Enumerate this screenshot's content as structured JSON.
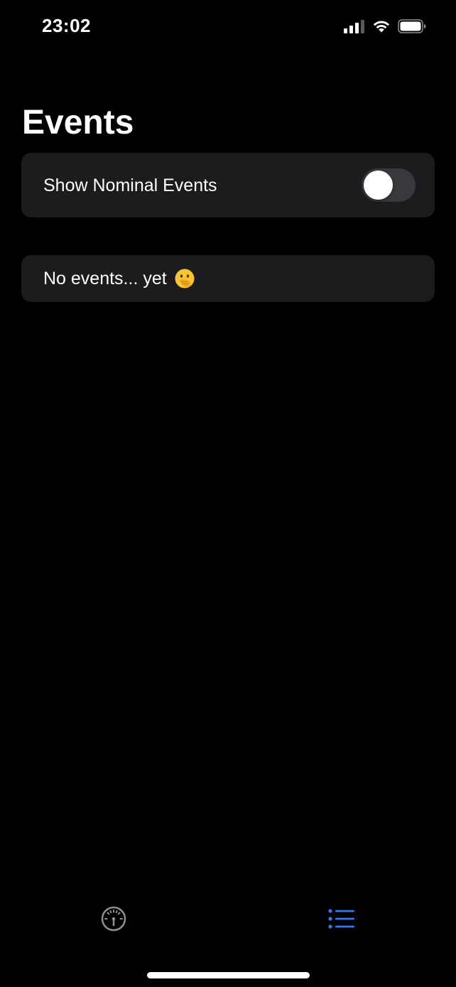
{
  "status_bar": {
    "time": "23:02",
    "icons": [
      "cellular-signal-icon",
      "wifi-icon",
      "battery-icon"
    ]
  },
  "header": {
    "title": "Events"
  },
  "settings": {
    "show_nominal_events_label": "Show Nominal Events",
    "show_nominal_events_enabled": false
  },
  "events": {
    "empty_message": "No events... yet",
    "empty_emoji": "face-with-hand-over-mouth-icon"
  },
  "tab_bar": {
    "tabs": [
      {
        "icon": "gauge-icon",
        "selected": false
      },
      {
        "icon": "list-icon",
        "selected": true
      }
    ]
  },
  "colors": {
    "background": "#000000",
    "card": "#1c1c1e",
    "accent": "#3478f6",
    "inactive_tab": "#8e8e93",
    "switch_off": "#39393d"
  }
}
